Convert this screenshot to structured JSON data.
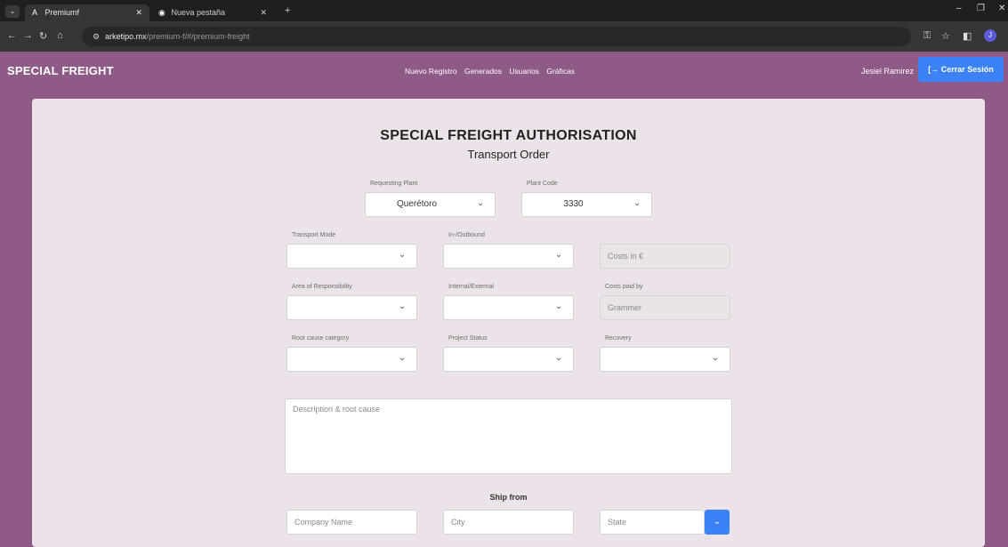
{
  "browser": {
    "tabs": [
      {
        "label": "Premiumf",
        "favicon": "A"
      },
      {
        "label": "Nueva pestaña",
        "favicon": "◉"
      }
    ],
    "url_host": "arketipo.mx",
    "url_path": "/premium-f/#/premium-freight"
  },
  "app": {
    "brand": "SPECIAL FREIGHT",
    "nav": [
      "Nuevo Registro",
      "Generados",
      "Usuarios",
      "Gráficas"
    ],
    "user": "Jesiel Ramirez",
    "logout_label": "Cerrar Sesión"
  },
  "form": {
    "title": "SPECIAL FREIGHT AUTHORISATION",
    "subtitle": "Transport Order",
    "requesting_plant": {
      "label": "Requesting Plant",
      "value": "Querétoro"
    },
    "plant_code": {
      "label": "Plant Code",
      "value": "3330"
    },
    "transport_mode": {
      "label": "Transport Mode",
      "value": ""
    },
    "in_outbound": {
      "label": "In-/Outbound",
      "value": ""
    },
    "costs": {
      "placeholder": "Costs in €"
    },
    "area_responsibility": {
      "label": "Area of Responsibility",
      "value": ""
    },
    "internal_external": {
      "label": "Internal/External",
      "value": ""
    },
    "costs_paid_by": {
      "label": "Costs paid by",
      "value": "Grammer"
    },
    "root_cause_category": {
      "label": "Root cause category",
      "value": ""
    },
    "project_status": {
      "label": "Project Status",
      "value": ""
    },
    "recovery": {
      "label": "Recovery",
      "value": ""
    },
    "description_placeholder": "Description & root cause",
    "ship_from": {
      "heading": "Ship from",
      "company_placeholder": "Company Name",
      "city_placeholder": "City",
      "state_placeholder": "State"
    }
  }
}
